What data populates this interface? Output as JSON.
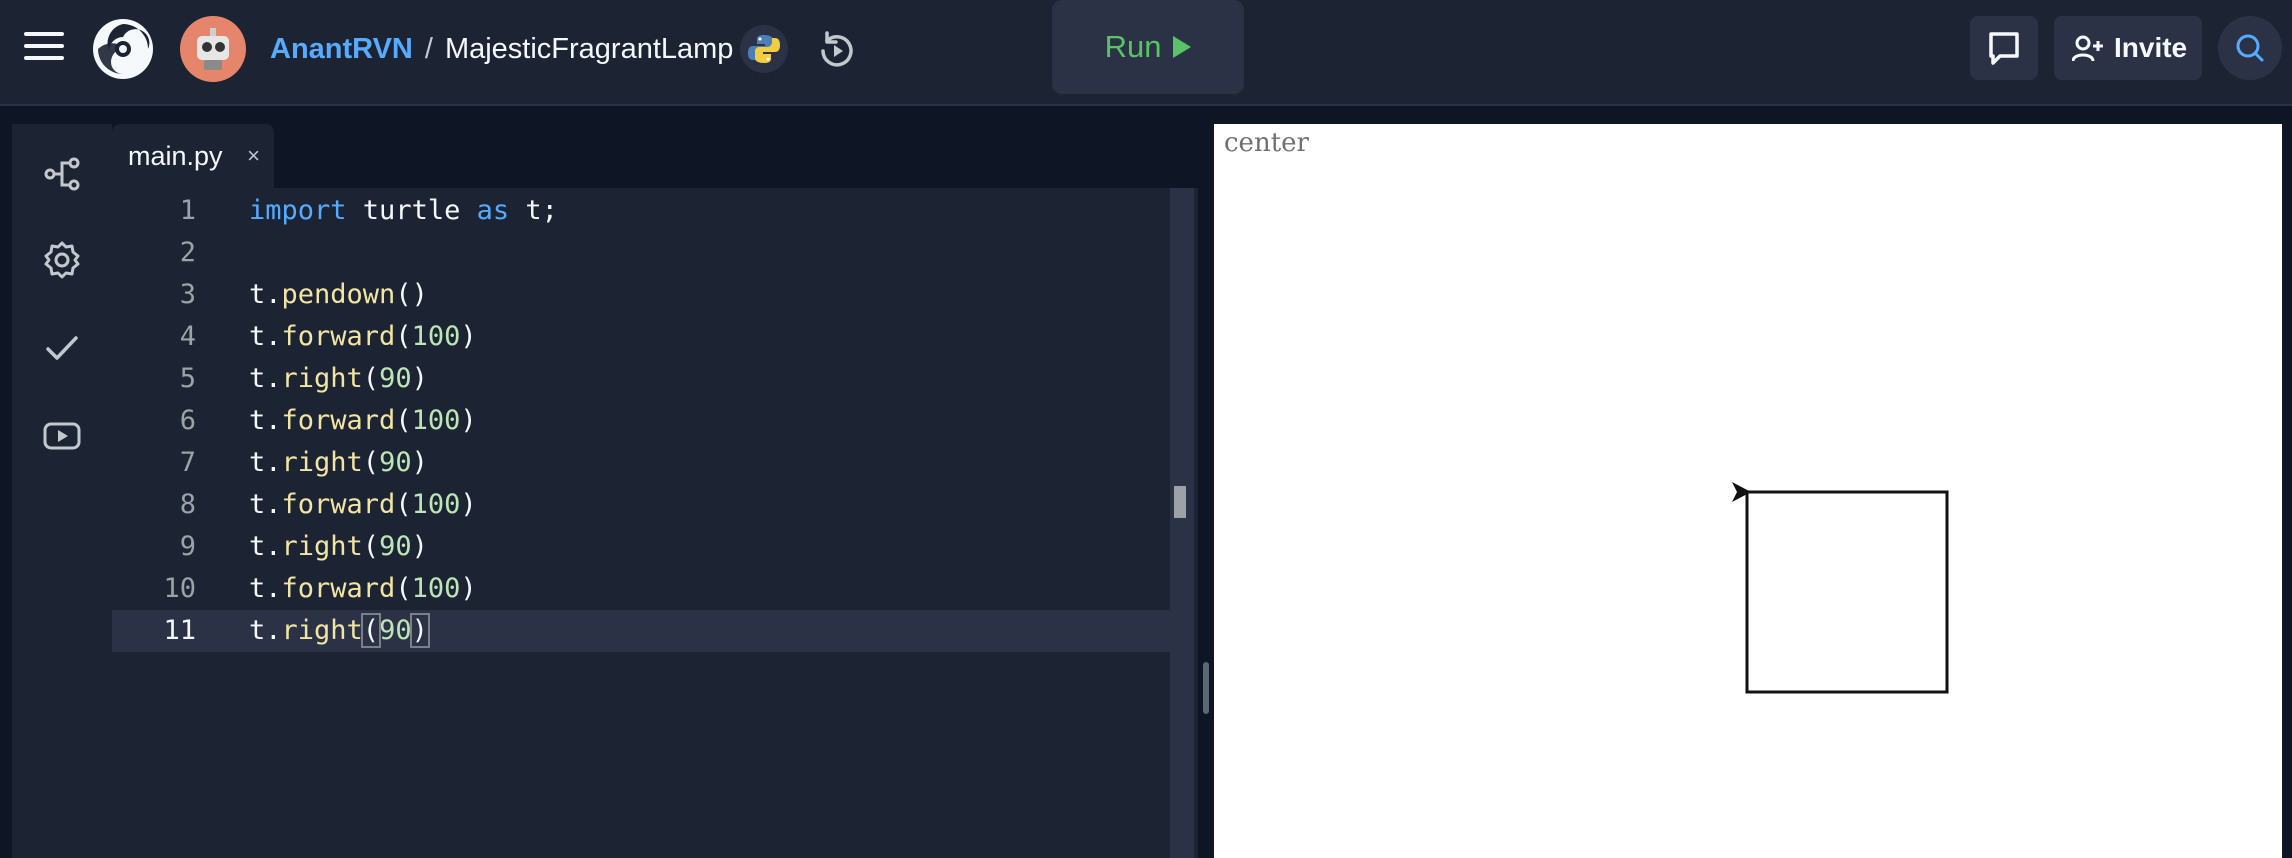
{
  "header": {
    "user": "AnantRVN",
    "separator": "/",
    "repl_name": "MajesticFragrantLamp",
    "run_label": "Run",
    "invite_label": "Invite"
  },
  "editor": {
    "tab_name": "main.py",
    "tab_close": "×",
    "lines": [
      {
        "n": "1",
        "text": "import turtle as t;"
      },
      {
        "n": "2",
        "text": ""
      },
      {
        "n": "3",
        "text": "t.pendown()"
      },
      {
        "n": "4",
        "text": "t.forward(100)"
      },
      {
        "n": "5",
        "text": "t.right(90)"
      },
      {
        "n": "6",
        "text": "t.forward(100)"
      },
      {
        "n": "7",
        "text": "t.right(90)"
      },
      {
        "n": "8",
        "text": "t.forward(100)"
      },
      {
        "n": "9",
        "text": "t.right(90)"
      },
      {
        "n": "10",
        "text": "t.forward(100)"
      },
      {
        "n": "11",
        "text": "t.right(90)"
      }
    ],
    "active_line": "11"
  },
  "output": {
    "canvas_label": "center"
  },
  "colors": {
    "accent_blue": "#57abff",
    "run_green": "#58c465",
    "bg_dark": "#0e1525",
    "panel": "#1c2333"
  }
}
